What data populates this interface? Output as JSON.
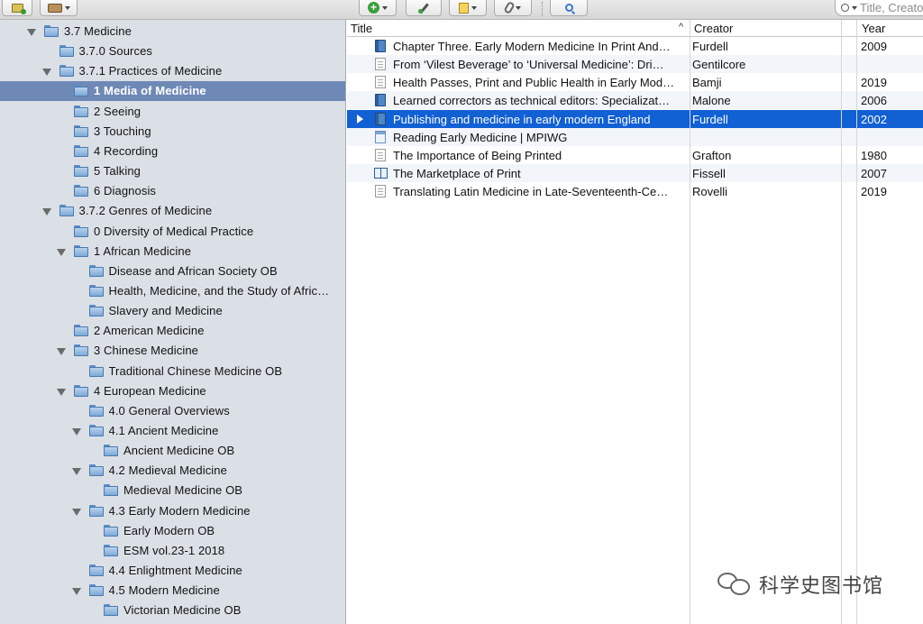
{
  "toolbar": {
    "buttons": [
      {
        "name": "new-collection-icon"
      },
      {
        "name": "new-library-icon"
      },
      {
        "name": "new-item-icon"
      },
      {
        "name": "add-by-identifier-icon"
      },
      {
        "name": "new-note-icon"
      },
      {
        "name": "attachment-icon"
      },
      {
        "name": "advanced-search-icon"
      }
    ],
    "search_placeholder": "Title, Creator, Year"
  },
  "sidebar": {
    "items": [
      {
        "label": "3.7 Medicine",
        "level": 0,
        "twisty": true
      },
      {
        "label": "3.7.0 Sources",
        "level": 1,
        "twisty": false
      },
      {
        "label": "3.7.1 Practices of Medicine",
        "level": 1,
        "twisty": true
      },
      {
        "label": "1 Media of Medicine",
        "level": 2,
        "twisty": false,
        "selected": true
      },
      {
        "label": "2 Seeing",
        "level": 2,
        "twisty": false
      },
      {
        "label": "3 Touching",
        "level": 2,
        "twisty": false
      },
      {
        "label": "4 Recording",
        "level": 2,
        "twisty": false
      },
      {
        "label": "5 Talking",
        "level": 2,
        "twisty": false
      },
      {
        "label": "6 Diagnosis",
        "level": 2,
        "twisty": false
      },
      {
        "label": "3.7.2 Genres of Medicine",
        "level": 1,
        "twisty": true
      },
      {
        "label": "0 Diversity of Medical Practice",
        "level": 2,
        "twisty": false
      },
      {
        "label": "1 African Medicine",
        "level": 2,
        "twisty": true
      },
      {
        "label": "Disease and African Society OB",
        "level": 3,
        "twisty": false
      },
      {
        "label": "Health, Medicine, and the Study of Afric…",
        "level": 3,
        "twisty": false
      },
      {
        "label": "Slavery and Medicine",
        "level": 3,
        "twisty": false
      },
      {
        "label": "2 American Medicine",
        "level": 2,
        "twisty": false
      },
      {
        "label": "3 Chinese Medicine",
        "level": 2,
        "twisty": true
      },
      {
        "label": "Traditional Chinese Medicine OB",
        "level": 3,
        "twisty": false
      },
      {
        "label": "4 European Medicine",
        "level": 2,
        "twisty": true
      },
      {
        "label": "4.0 General Overviews",
        "level": 3,
        "twisty": false
      },
      {
        "label": "4.1 Ancient Medicine",
        "level": 3,
        "twisty": true
      },
      {
        "label": "Ancient Medicine OB",
        "level": 4,
        "twisty": false
      },
      {
        "label": "4.2 Medieval Medicine",
        "level": 3,
        "twisty": true
      },
      {
        "label": "Medieval Medicine OB",
        "level": 4,
        "twisty": false
      },
      {
        "label": "4.3 Early Modern Medicine",
        "level": 3,
        "twisty": true
      },
      {
        "label": "Early Modern OB",
        "level": 4,
        "twisty": false
      },
      {
        "label": "ESM vol.23-1 2018",
        "level": 4,
        "twisty": false
      },
      {
        "label": "4.4 Enlightment Medicine",
        "level": 3,
        "twisty": false
      },
      {
        "label": "4.5 Modern Medicine",
        "level": 3,
        "twisty": true
      },
      {
        "label": "Victorian Medicine OB",
        "level": 4,
        "twisty": false
      }
    ]
  },
  "items_table": {
    "columns": {
      "title": "Title",
      "creator": "Creator",
      "year": "Year"
    },
    "rows": [
      {
        "type": "book",
        "title": "Chapter Three. Early Modern Medicine In Print And…",
        "creator": "Furdell",
        "year": "2009"
      },
      {
        "type": "document",
        "title": "From ‘Vilest Beverage’ to ‘Universal Medicine’: Dri…",
        "creator": "Gentilcore",
        "year": ""
      },
      {
        "type": "document",
        "title": "Health Passes, Print and Public Health in Early Mod…",
        "creator": "Bamji",
        "year": "2019"
      },
      {
        "type": "book",
        "title": "Learned correctors as technical editors: Specializat…",
        "creator": "Malone",
        "year": "2006"
      },
      {
        "type": "book",
        "title": "Publishing and medicine in early modern England",
        "creator": "Furdell",
        "year": "2002",
        "selected": true
      },
      {
        "type": "webpage",
        "title": "Reading Early Medicine | MPIWG",
        "creator": "",
        "year": ""
      },
      {
        "type": "document",
        "title": "The Importance of Being Printed",
        "creator": "Grafton",
        "year": "1980"
      },
      {
        "type": "openbook",
        "title": "The Marketplace of Print",
        "creator": "Fissell",
        "year": "2007"
      },
      {
        "type": "document",
        "title": "Translating Latin Medicine in Late-Seventeenth-Ce…",
        "creator": "Rovelli",
        "year": "2019"
      }
    ]
  },
  "watermark": {
    "text": "科学史图书馆"
  }
}
